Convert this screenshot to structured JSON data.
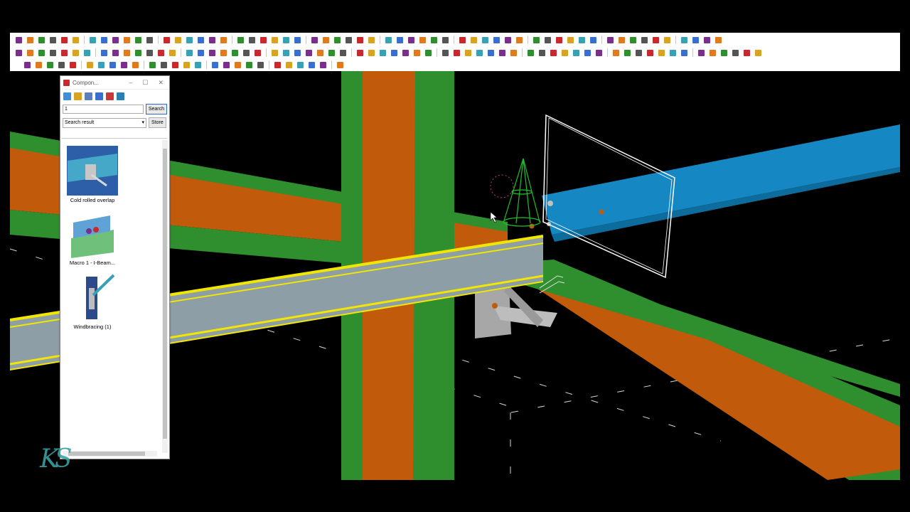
{
  "colors": {
    "column_green": "#2f8f2e",
    "column_orange": "#c25a0c",
    "beam_grey": "#8e9ea6",
    "beam_highlight": "#f0e600",
    "beam_blue": "#1587c3",
    "plate_grey": "#a7a7a7",
    "toolbar_bg": "#ffffff"
  },
  "components_panel": {
    "title": "Compon...",
    "search_value": "1",
    "search_button": "Search",
    "filter_selected": "Search result",
    "store_button": "Store",
    "items": [
      {
        "label": "Cold rolled overlap"
      },
      {
        "label": "Macro 1 - I-Beam..."
      },
      {
        "label": "Windbracing (1)"
      }
    ]
  },
  "logo_text": "KS"
}
